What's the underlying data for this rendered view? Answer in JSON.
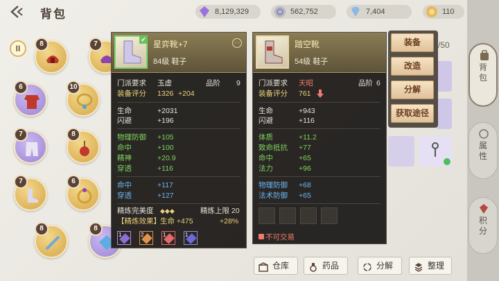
{
  "header": {
    "title": "背包",
    "back_icon": "back-arrow-icon"
  },
  "currencies": [
    {
      "value": "8,129,329",
      "icon": "crystal-icon",
      "color": "#9b6fe0"
    },
    {
      "value": "562,752",
      "icon": "silver-coin-icon",
      "color": "#a8a8c8"
    },
    {
      "value": "7,404",
      "icon": "diamond-icon",
      "color": "#8fb6e8"
    },
    {
      "value": "110",
      "icon": "gold-coin-icon",
      "color": "#e8b75a"
    }
  ],
  "side_tabs": [
    {
      "label": "背包",
      "icon": "bag-icon"
    },
    {
      "label": "属性",
      "icon": "attribute-icon"
    },
    {
      "label": "积分",
      "icon": "points-icon"
    }
  ],
  "inventory": {
    "pause_label": "II",
    "page_count": "/50",
    "slots": [
      {
        "level": "8",
        "type": "helmet",
        "color": "gold"
      },
      {
        "level": "7",
        "type": "helmet",
        "color": "gold"
      },
      {
        "level": "6",
        "type": "armor",
        "color": "purple"
      },
      {
        "level": "10",
        "type": "necklace",
        "color": "gold"
      },
      {
        "level": "7",
        "type": "pants",
        "color": "purple"
      },
      {
        "level": "8",
        "type": "pendant",
        "color": "gold"
      },
      {
        "level": "7",
        "type": "boots",
        "color": "gold"
      },
      {
        "level": "6",
        "type": "ring",
        "color": "gold"
      },
      {
        "level": "8",
        "type": "sword",
        "color": "gold"
      },
      {
        "level": "8",
        "type": "gem",
        "color": "purple"
      }
    ]
  },
  "tooltip_equipped": {
    "name": "星弈靴+7",
    "level": "84级",
    "slot": "鞋子",
    "sect_label": "门派要求",
    "sect_value": "玉虚",
    "grade_label": "品阶",
    "grade_value": "9",
    "score_label": "装备评分",
    "score_value": "1326",
    "score_bonus": "+204",
    "base_stats": [
      {
        "name": "生命",
        "value": "+2031"
      },
      {
        "name": "闪避",
        "value": "+196"
      }
    ],
    "green_stats": [
      {
        "name": "物理防御",
        "value": "+105"
      },
      {
        "name": "命中",
        "value": "+100"
      },
      {
        "name": "精神",
        "value": "+20.9"
      },
      {
        "name": "穿透",
        "value": "+116"
      }
    ],
    "blue_stats": [
      {
        "name": "命中",
        "value": "+117"
      },
      {
        "name": "穿透",
        "value": "+127"
      }
    ],
    "refine_label": "精炼完美度",
    "refine_diamonds": "◆◆◆",
    "refine_limit": "精炼上限 20",
    "refine_effect_label": "【精炼效果】",
    "refine_effect": "生命 +475",
    "refine_pct": "+28%",
    "gems": [
      {
        "n": "1",
        "color": "#8b6fd4"
      },
      {
        "n": "2",
        "color": "#e2934a"
      },
      {
        "n": "1",
        "color": "#e66a6a"
      },
      {
        "n": "1",
        "color": "#6a6bd8"
      }
    ]
  },
  "tooltip_new": {
    "name": "踏空靴",
    "level": "54级",
    "slot": "鞋子",
    "sect_label": "门派要求",
    "sect_value": "天昭",
    "grade_label": "品阶",
    "grade_value": "6",
    "score_label": "装备评分",
    "score_value": "761",
    "base_stats": [
      {
        "name": "生命",
        "value": "+943"
      },
      {
        "name": "闪避",
        "value": "+116"
      }
    ],
    "green_stats": [
      {
        "name": "体质",
        "value": "+11.2"
      },
      {
        "name": "致命抵抗",
        "value": "+77"
      },
      {
        "name": "命中",
        "value": "+65"
      },
      {
        "name": "法力",
        "value": "+96"
      }
    ],
    "blue_stats": [
      {
        "name": "物理防御",
        "value": "+68"
      },
      {
        "name": "法术防御",
        "value": "+65"
      }
    ],
    "untradable": "不可交易"
  },
  "actions": [
    "装备",
    "改造",
    "分解",
    "获取途径"
  ],
  "bottom_buttons": [
    {
      "label": "仓库",
      "icon": "warehouse-icon"
    },
    {
      "label": "药品",
      "icon": "potion-icon"
    },
    {
      "label": "分解",
      "icon": "recycle-icon"
    },
    {
      "label": "整理",
      "icon": "sort-icon"
    }
  ]
}
